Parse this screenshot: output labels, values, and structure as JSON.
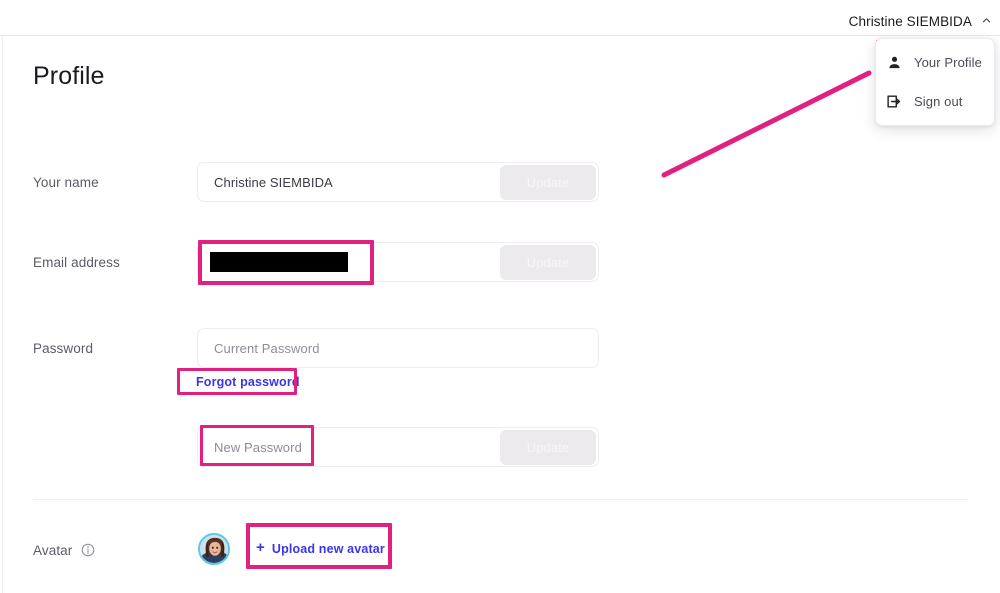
{
  "header": {
    "account_name": "Christine SIEMBIDA",
    "chevron_icon": "chevron-up-icon"
  },
  "dropdown": {
    "items": [
      {
        "label": "Your Profile",
        "icon": "person-icon",
        "highlighted": true
      },
      {
        "label": "Sign out",
        "icon": "sign-out-icon",
        "highlighted": false
      }
    ]
  },
  "main": {
    "title": "Profile",
    "rows": {
      "name": {
        "label": "Your name",
        "value": "Christine SIEMBIDA",
        "button_label": "Update"
      },
      "email": {
        "label": "Email address",
        "value": "",
        "redacted": true,
        "button_label": "Update"
      },
      "password": {
        "label": "Password",
        "current_placeholder": "Current Password",
        "forgot_link": "Forgot password",
        "new_placeholder": "New Password",
        "button_label": "Update"
      },
      "avatar": {
        "label": "Avatar",
        "info_icon": "info-icon",
        "upload_link": "Upload new avatar",
        "plus": "+"
      }
    }
  },
  "annotations": {
    "accent_color": "#e0217f",
    "link_color": "#3b35e8",
    "boxes": [
      {
        "name": "your-profile-menu-item"
      },
      {
        "name": "email-value"
      },
      {
        "name": "forgot-password-link"
      },
      {
        "name": "new-password-field"
      },
      {
        "name": "upload-new-avatar-link"
      }
    ],
    "arrow": {
      "name": "pointer-arrow"
    }
  }
}
